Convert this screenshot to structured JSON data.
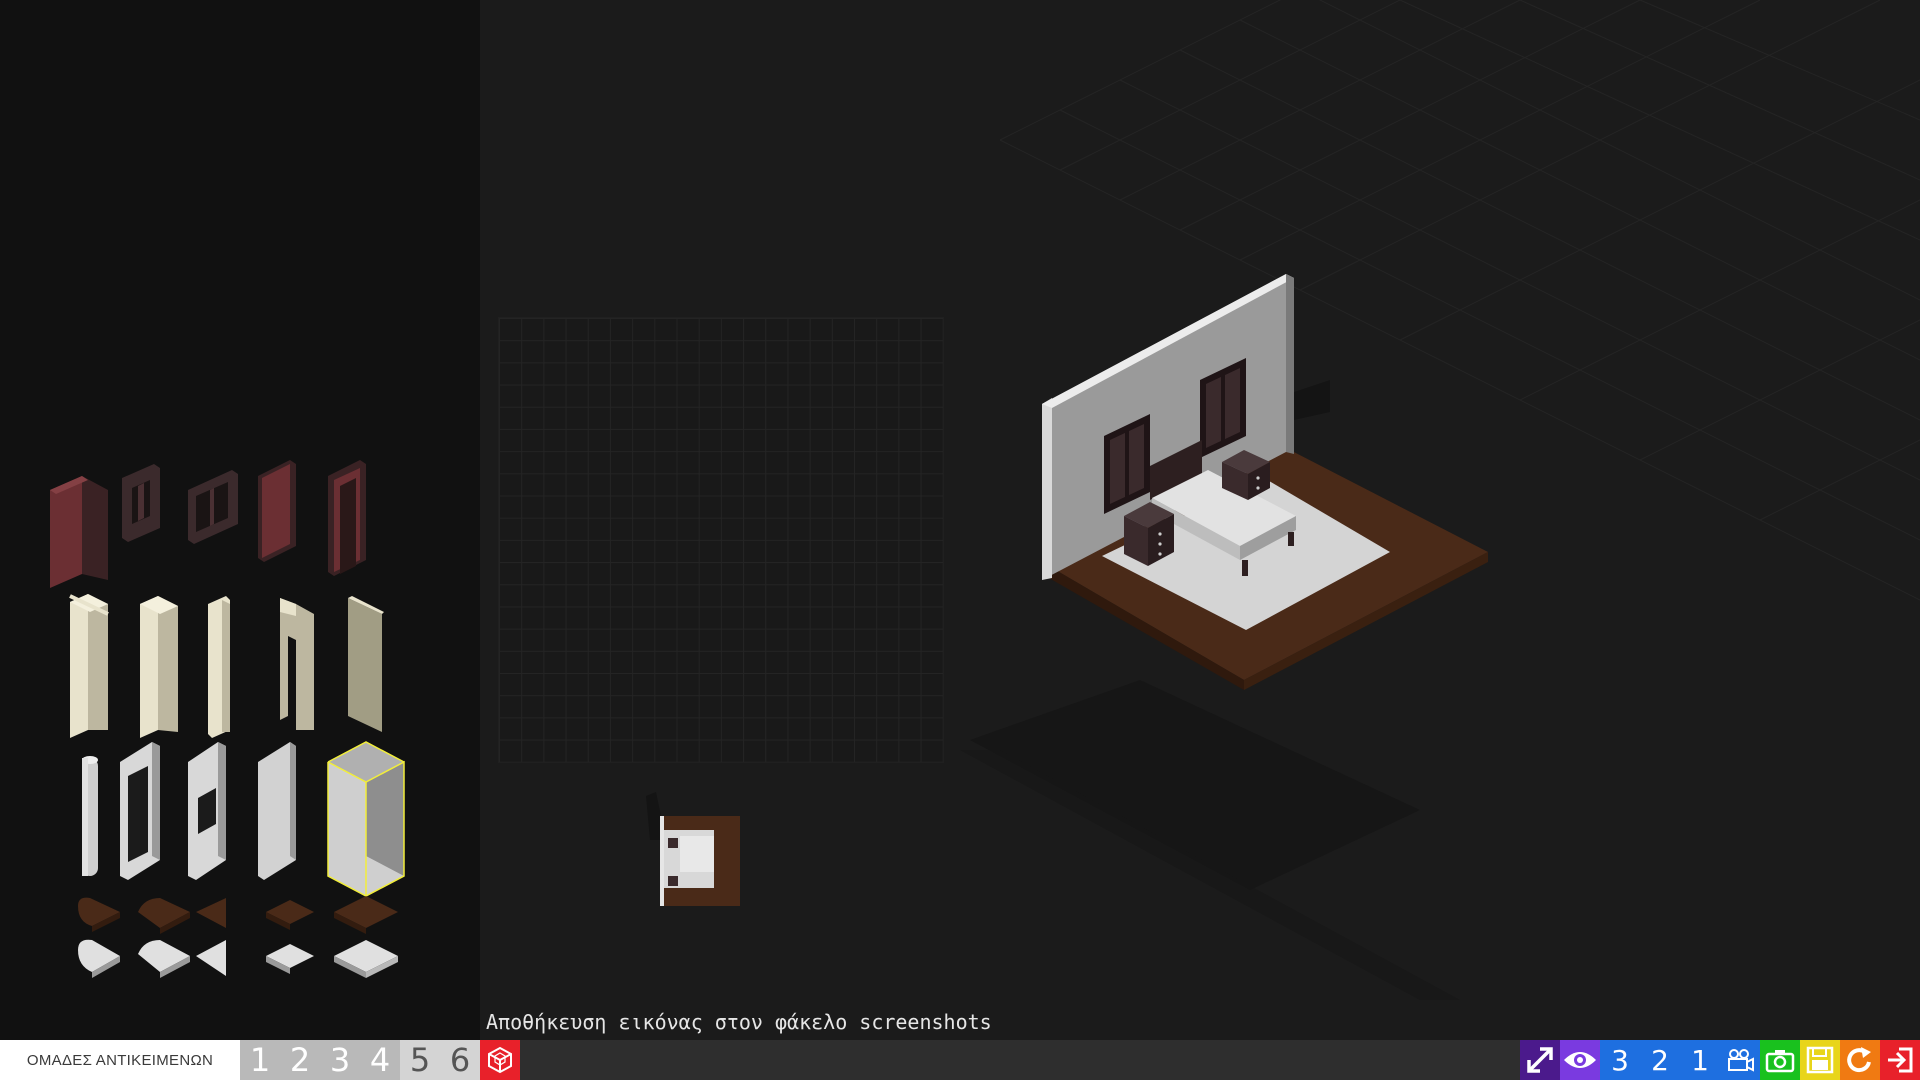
{
  "status": {
    "message": "Αποθήκευση εικόνας στον φάκελο screenshots"
  },
  "bottom_bar": {
    "groups_label": "ΟΜΑΔΕΣ ΑΝΤΙΚΕΙΜΕΝΩΝ",
    "group_tabs": [
      "1",
      "2",
      "3",
      "4",
      "5",
      "6"
    ],
    "active_group_count": 4,
    "tools": [
      {
        "name": "fullscreen-button",
        "icon": "fullscreen-arrows-icon",
        "color": "#4b1a8c"
      },
      {
        "name": "visibility-button",
        "icon": "eye-icon",
        "color": "#7a3ae0"
      },
      {
        "name": "view-3-button",
        "label": "3",
        "color": "#1e6fe0"
      },
      {
        "name": "view-2-button",
        "label": "2",
        "color": "#1e6fe0"
      },
      {
        "name": "view-1-button",
        "label": "1",
        "color": "#1e6fe0"
      },
      {
        "name": "camera-view-button",
        "icon": "video-camera-icon",
        "color": "#1e6fe0"
      },
      {
        "name": "screenshot-button",
        "icon": "photo-camera-icon",
        "color": "#19c11e"
      },
      {
        "name": "save-button",
        "icon": "floppy-disk-icon",
        "color": "#e8d51a"
      },
      {
        "name": "reset-button",
        "icon": "refresh-icon",
        "color": "#f07a12"
      },
      {
        "name": "exit-button",
        "icon": "exit-icon",
        "color": "#e8212a"
      }
    ]
  },
  "colors": {
    "panel_bg": "#111111",
    "viewport_bg": "#1b1b1b",
    "wall": "#9a9a9a",
    "floor_wood": "#4a2a18",
    "rug": "#d6d6d6",
    "furniture_dark": "#3a2a2c",
    "door_red": "#6b2f33",
    "beige_wall_piece": "#cfcab3"
  }
}
